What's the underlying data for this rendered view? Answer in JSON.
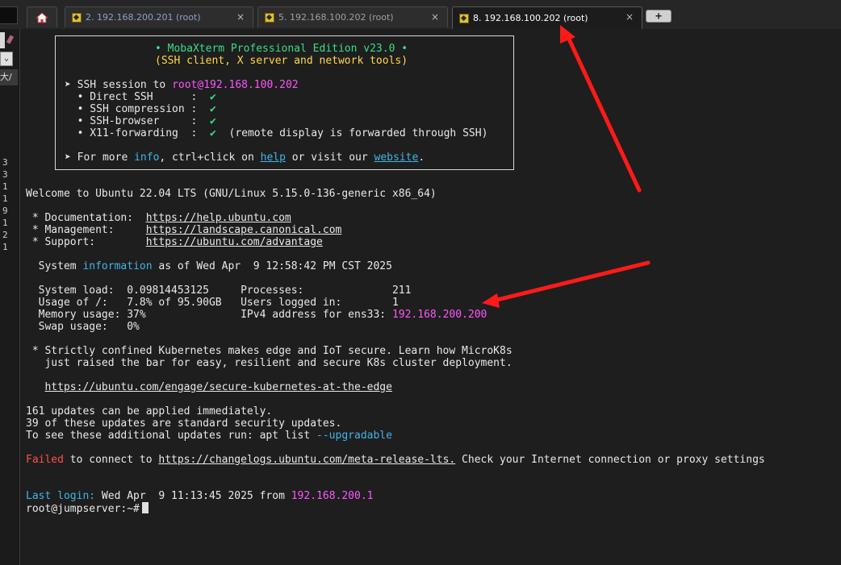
{
  "tabs": [
    {
      "label": "2. 192.168.200.201 (root)",
      "close": "×"
    },
    {
      "label": "5. 192.168.100.202 (root)",
      "close": "×"
    },
    {
      "label": "8. 192.168.100.202 (root)",
      "close": "×"
    }
  ],
  "new_tab": "+",
  "side": {
    "cjk": "大/",
    "numbers": [
      "3",
      "3",
      "1",
      "1",
      "9",
      "1",
      "2",
      "1"
    ]
  },
  "banner": {
    "title": "• MobaXterm Professional Edition v23.0 •",
    "subtitle": "(SSH client, X server and network tools)",
    "session_prefix": "➤ SSH session to ",
    "session_target": "root@192.168.100.202",
    "features": [
      {
        "label": "  • Direct SSH      :  ",
        "mark": "✔",
        "note": ""
      },
      {
        "label": "  • SSH compression :  ",
        "mark": "✔",
        "note": ""
      },
      {
        "label": "  • SSH-browser     :  ",
        "mark": "✔",
        "note": ""
      },
      {
        "label": "  • X11-forwarding  :  ",
        "mark": "✔",
        "note": "  (remote display is forwarded through SSH)"
      }
    ],
    "more_a": "➤ For more ",
    "more_info": "info",
    "more_b": ", ctrl+click on ",
    "more_help": "help",
    "more_c": " or visit our ",
    "more_site": "website",
    "more_d": "."
  },
  "welcome": "Welcome to Ubuntu 22.04 LTS (GNU/Linux 5.15.0-136-generic x86_64)",
  "links": [
    {
      "label": " * Documentation:  ",
      "url": "https://help.ubuntu.com"
    },
    {
      "label": " * Management:     ",
      "url": "https://landscape.canonical.com"
    },
    {
      "label": " * Support:        ",
      "url": "https://ubuntu.com/advantage"
    }
  ],
  "sysinfo": {
    "pre": "  System ",
    "word": "information",
    "post": " as of Wed Apr  9 12:58:42 PM CST 2025"
  },
  "stats": [
    {
      "text": "  System load:  0.09814453125     Processes:              211",
      "ip": ""
    },
    {
      "text": "  Usage of /:   7.8% of 95.90GB   Users logged in:        1",
      "ip": ""
    },
    {
      "text": "  Memory usage: 37%               IPv4 address for ens33: ",
      "ip": "192.168.200.200"
    },
    {
      "text": "  Swap usage:   0%",
      "ip": ""
    }
  ],
  "k8s": [
    " * Strictly confined Kubernetes makes edge and IoT secure. Learn how MicroK8s",
    "   just raised the bar for easy, resilient and secure K8s cluster deployment."
  ],
  "k8s_url": "https://ubuntu.com/engage/secure-kubernetes-at-the-edge",
  "updates": [
    "161 updates can be applied immediately.",
    "39 of these updates are standard security updates.",
    "To see these additional updates run: apt list "
  ],
  "upgradable": "--upgradable",
  "failed": {
    "word": "Failed",
    "a": " to connect to ",
    "url": "https://changelogs.ubuntu.com/meta-release-lts.",
    "b": " Check your Internet connection or proxy settings"
  },
  "last_login": {
    "label": "Last login:",
    "text": " Wed Apr  9 11:13:45 2025 from ",
    "ip": "192.168.200.1"
  },
  "prompt": "root@jumpserver:~#",
  "colors": {
    "arrow": "#ff1a1a",
    "link": "#3fb5e8",
    "ip": "#ff55ff",
    "green": "#3ddc84",
    "yellow": "#ffd84a",
    "failed": "#ff4f4f"
  }
}
